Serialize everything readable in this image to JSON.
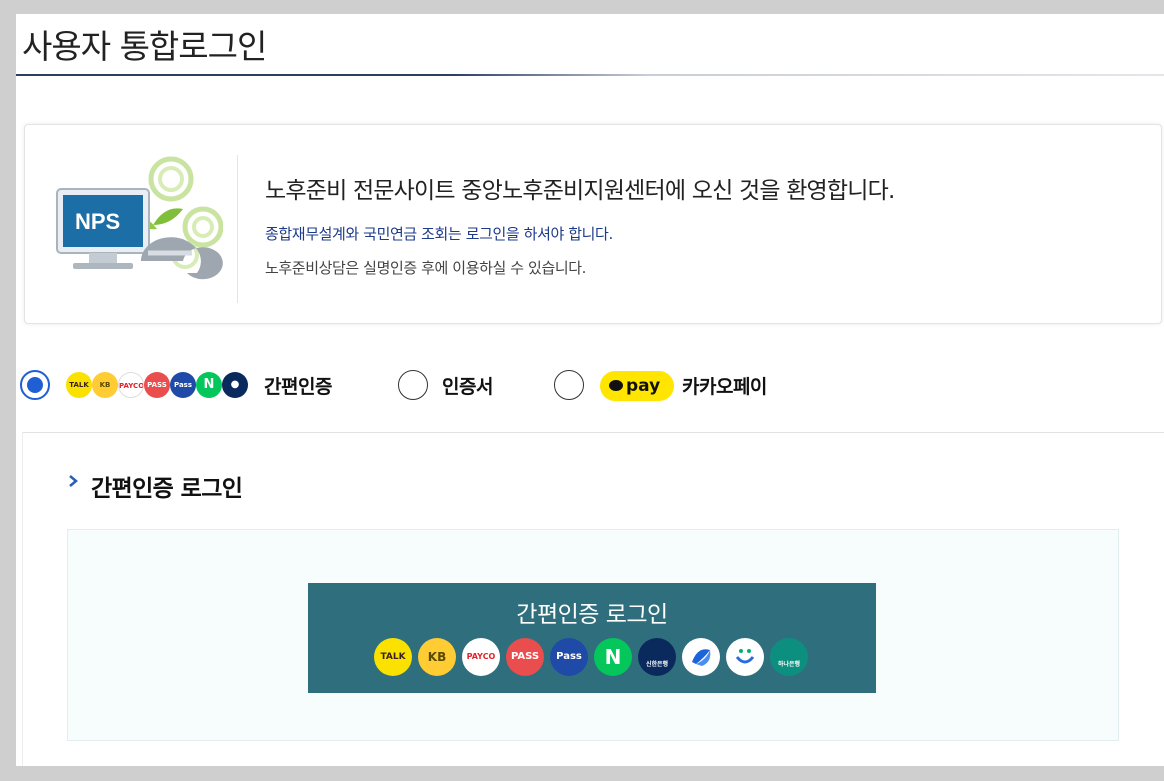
{
  "page": {
    "title": "사용자 통합로그인"
  },
  "welcome": {
    "logo_text": "NPS",
    "heading": "노후준비 전문사이트 중앙노후준비지원센터에 오신 것을 환영합니다.",
    "sub1": "종합재무설계와 국민연금 조회는 로그인을 하셔야 합니다.",
    "sub2": "노후준비상담은 실명인증 후에 이용하실 수 있습니다."
  },
  "options": {
    "simple": {
      "label": "간편인증",
      "selected": true
    },
    "cert": {
      "label": "인증서",
      "selected": false
    },
    "kakaopay": {
      "label": "카카오페이",
      "pill_text": "pay",
      "selected": false
    },
    "mini_icon_names": [
      "kakaotalk-icon",
      "kb-icon",
      "payco-icon",
      "pass-icon",
      "samsung-pass-icon",
      "naver-icon",
      "shinhan-icon"
    ]
  },
  "login_section": {
    "title": "간편인증 로그인",
    "button_label": "간편인증 로그인",
    "providers": [
      {
        "icon": "kakaotalk-icon",
        "text": "TALK",
        "color": "#fae100"
      },
      {
        "icon": "kb-icon",
        "text": "KB",
        "color": "#ffcc33"
      },
      {
        "icon": "payco-icon",
        "text": "PAYCO",
        "color": "#ffffff"
      },
      {
        "icon": "pass-icon",
        "text": "PASS",
        "color": "#ea4d4d"
      },
      {
        "icon": "samsung-pass-icon",
        "text": "Pass",
        "color": "#1f4aa8"
      },
      {
        "icon": "naver-icon",
        "text": "N",
        "color": "#03c75a"
      },
      {
        "icon": "shinhan-icon",
        "text": "신한은행",
        "color": "#0a2a5e"
      },
      {
        "icon": "toss-icon",
        "text": "",
        "color": "#ffffff"
      },
      {
        "icon": "banksalad-icon",
        "text": "",
        "color": "#ffffff"
      },
      {
        "icon": "hana-icon",
        "text": "하나은행",
        "color": "#0d8f80"
      }
    ]
  },
  "colors": {
    "accent": "#1f5fd3",
    "button_bg": "#2f6f7d",
    "title_rule": "#2b3e63",
    "sub_link_blue": "#1d3b8a"
  }
}
